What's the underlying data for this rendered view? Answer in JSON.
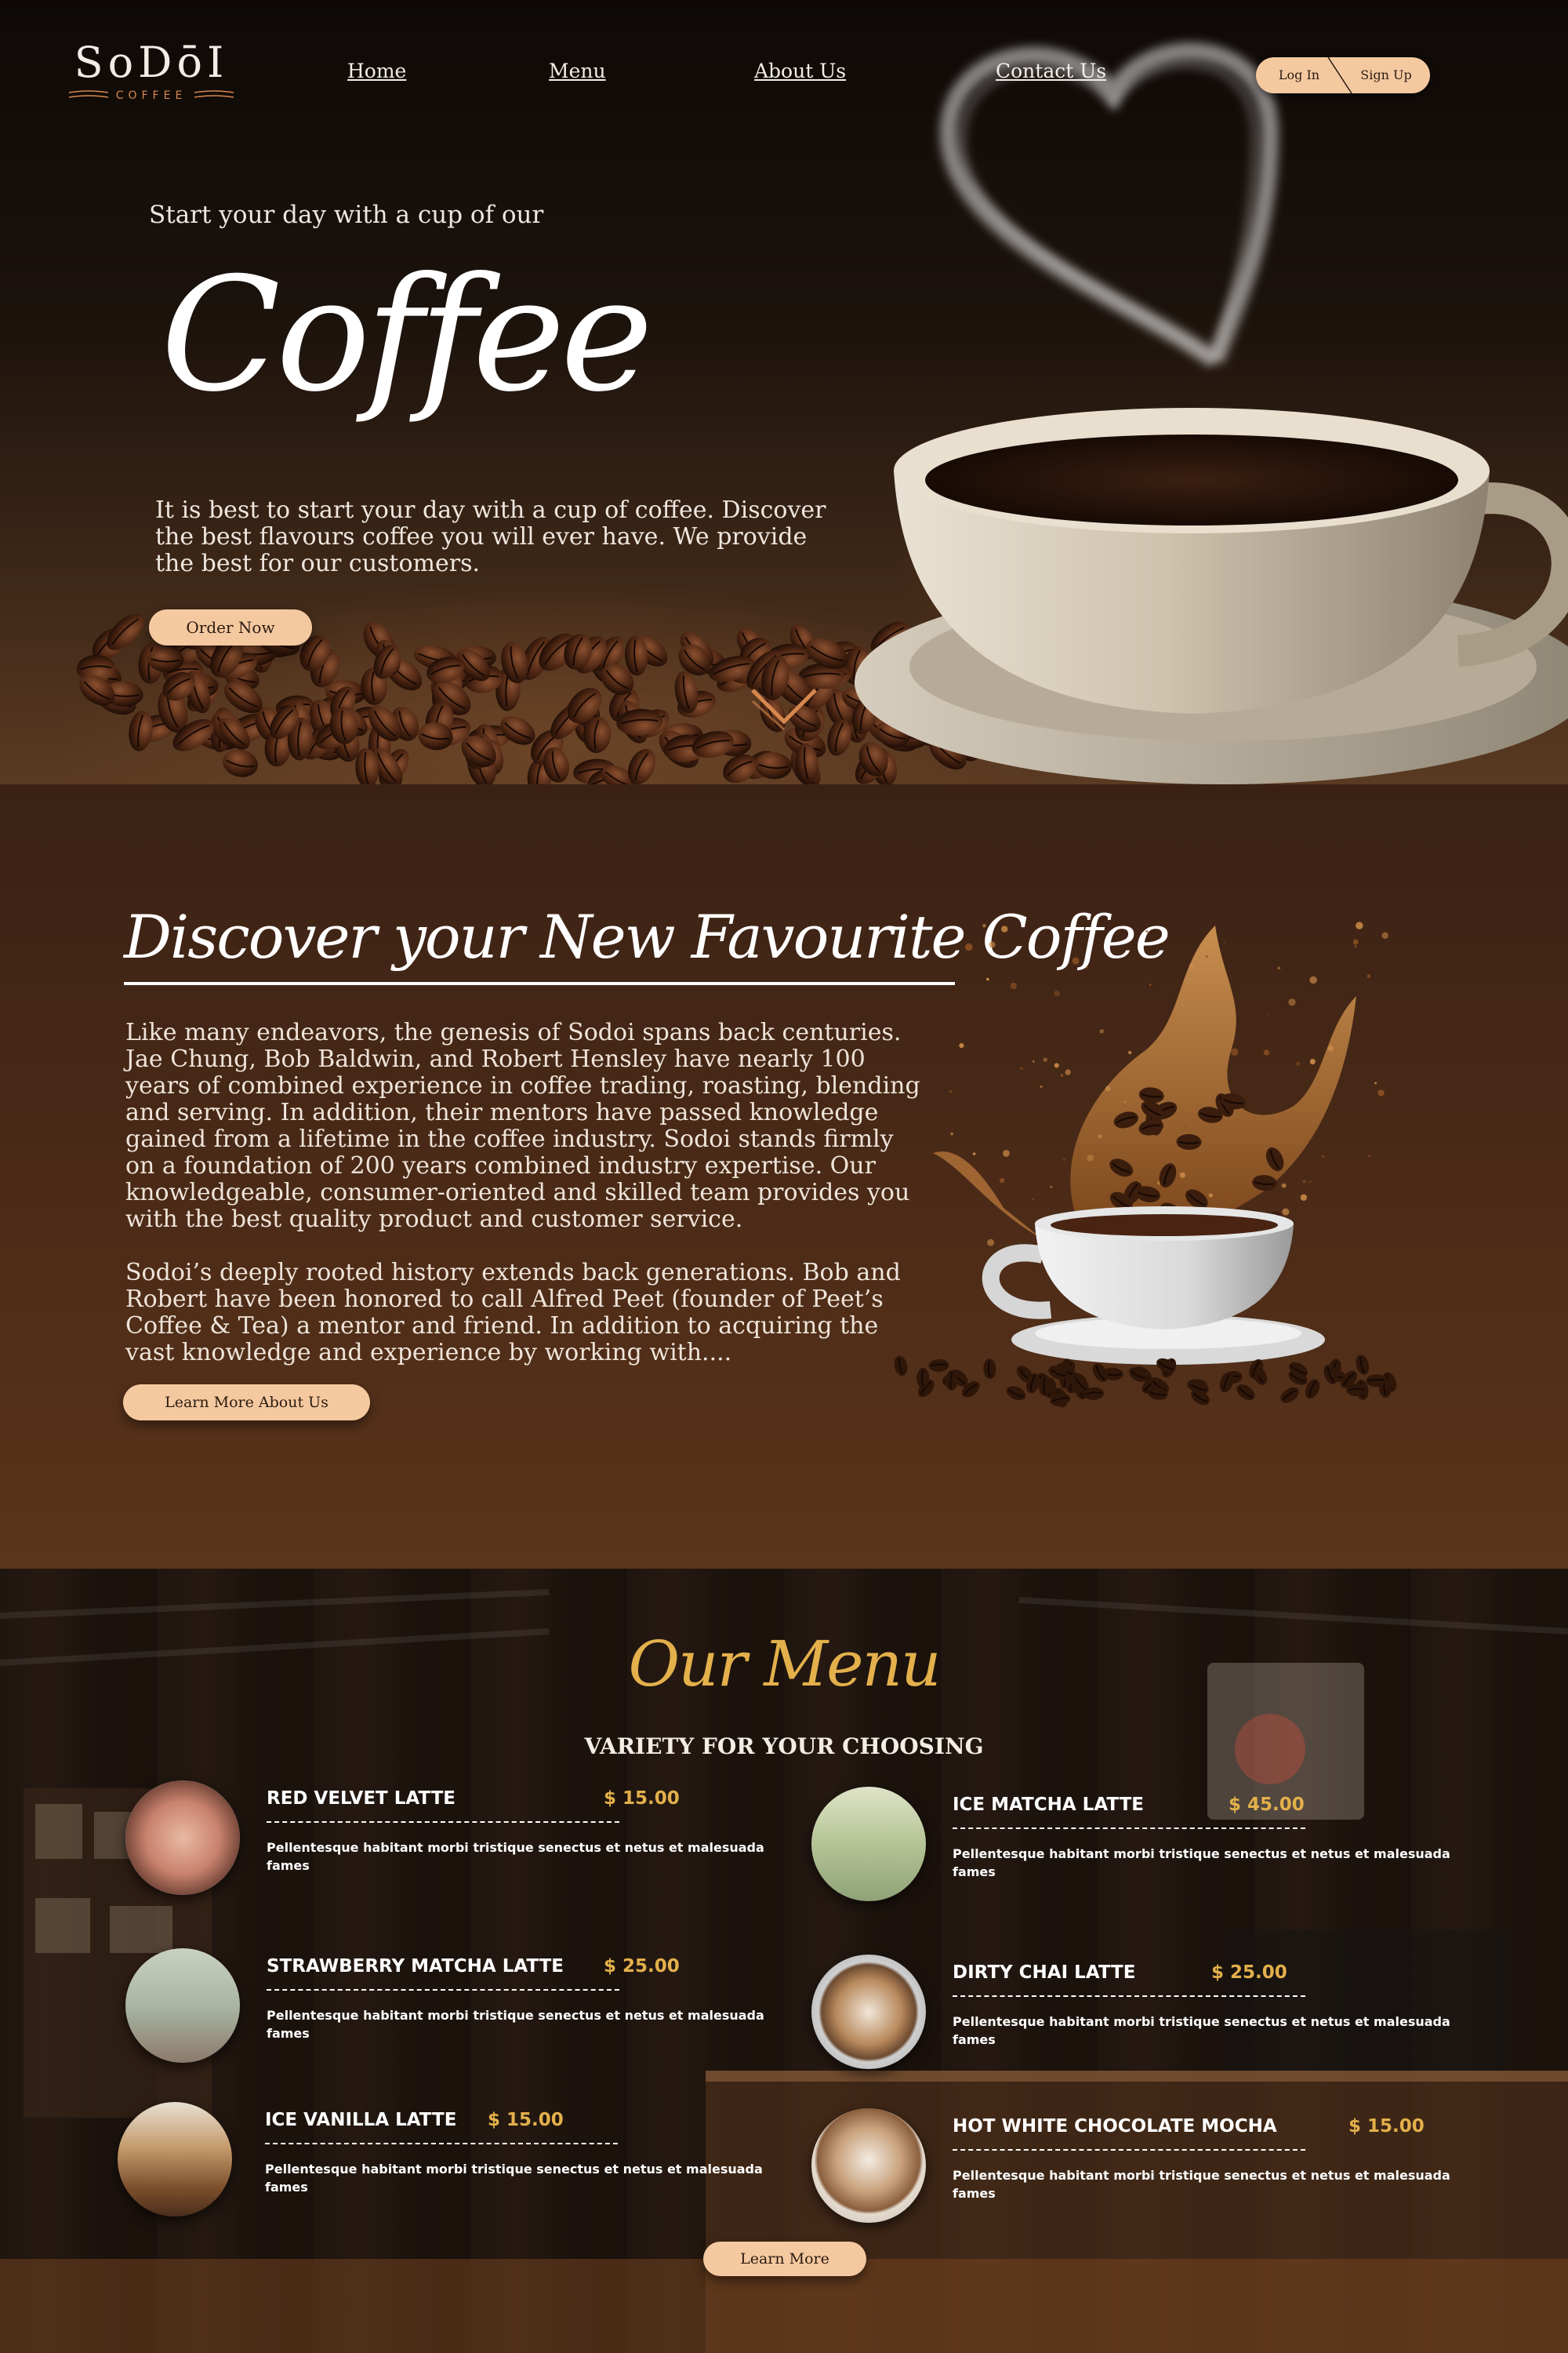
{
  "header": {
    "logo_text": "SoDōI",
    "logo_subtext": "COFFEE",
    "nav": [
      "Home",
      "Menu",
      "About Us",
      "Contact Us"
    ],
    "login_label": "Log In",
    "signup_label": "Sign Up"
  },
  "hero": {
    "pretitle": "Start your day with a cup of our",
    "title": "Coffee",
    "description": "It is best to start your day with a cup of coffee. Discover the best flavours coffee you will ever have. We provide the best for our customers.",
    "cta_label": "Order Now"
  },
  "about": {
    "title": "Discover your New Favourite Coffee",
    "paragraph_1": "Like many endeavors, the genesis of Sodoi spans back centuries. Jae Chung, Bob Baldwin, and Robert Hensley have nearly 100 years of combined experience in coffee trading, roasting, blending and serving. In addition, their mentors have passed knowledge gained from a lifetime in the coffee industry. Sodoi stands firmly on a foundation of 200 years combined industry expertise. Our knowledgeable, consumer-oriented and skilled team provides you with the best quality product and customer service.",
    "paragraph_2": "Sodoi’s deeply rooted history extends back generations. Bob and Robert have been honored to call Alfred Peet (founder of Peet’s Coffee & Tea) a mentor and friend. In addition to acquiring the vast knowledge and experience by working with....",
    "cta_label": "Learn More About Us"
  },
  "menu": {
    "title": "Our Menu",
    "subtitle": "VARIETY FOR YOUR CHOOSING",
    "items": [
      {
        "name": "RED VELVET LATTE",
        "price": "$  15.00",
        "description": "Pellentesque habitant morbi tristique senectus et netus et malesuada fames"
      },
      {
        "name": "ICE MATCHA LATTE",
        "price": "$  45.00",
        "description": "Pellentesque habitant morbi tristique senectus et netus et malesuada fames"
      },
      {
        "name": "STRAWBERRY MATCHA LATTE",
        "price": "$  25.00",
        "description": "Pellentesque habitant morbi tristique senectus et netus et malesuada fames"
      },
      {
        "name": "DIRTY CHAI LATTE",
        "price": "$  25.00",
        "description": "Pellentesque habitant morbi tristique senectus et netus et malesuada fames"
      },
      {
        "name": "ICE VANILLA LATTE",
        "price": "$  15.00",
        "description": "Pellentesque habitant morbi tristique senectus et netus et malesuada fames"
      },
      {
        "name": "HOT WHITE CHOCOLATE MOCHA",
        "price": "$  15.00",
        "description": "Pellentesque habitant morbi tristique senectus et netus et malesuada fames"
      }
    ],
    "cta_label": "Learn More"
  },
  "colors": {
    "accent_peach": "#f5c9a0",
    "menu_gold": "#e3b04b",
    "logo_orange": "#d7884f",
    "about_brown": "#4a2a17"
  }
}
